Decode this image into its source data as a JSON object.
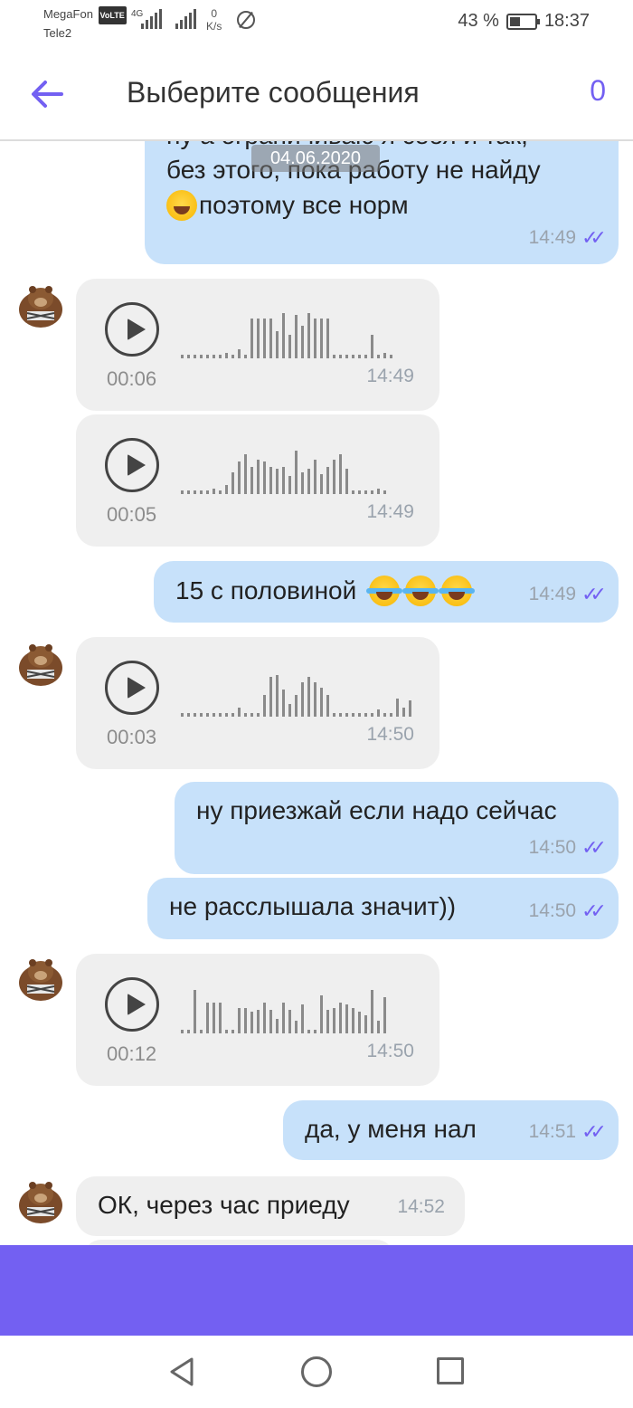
{
  "status_bar": {
    "carrier1": "MegaFon",
    "volte": "VoLTE",
    "network1": "4G",
    "carrier2": "Tele2",
    "speed_value": "0",
    "speed_unit": "K/s",
    "battery": "43 %",
    "battery_level": 0.43,
    "time": "18:37"
  },
  "header": {
    "title": "Выберите сообщения",
    "selected_count": "0"
  },
  "chat": {
    "date_chip": "04.06.2020",
    "messages": [
      {
        "type": "text",
        "direction": "out",
        "text_line1": "ну а ограничиваю я себя и так,",
        "text_line2": "без этого, пока работу не найду",
        "text_line3": "поэтому все норм",
        "time": "14:49"
      },
      {
        "type": "voice",
        "direction": "in",
        "duration": "00:06",
        "time": "14:49"
      },
      {
        "type": "voice",
        "direction": "in",
        "duration": "00:05",
        "time": "14:49"
      },
      {
        "type": "text",
        "direction": "out",
        "text": "15 с половиной",
        "time": "14:49"
      },
      {
        "type": "voice",
        "direction": "in",
        "duration": "00:03",
        "time": "14:50"
      },
      {
        "type": "text",
        "direction": "out",
        "text": "ну приезжай если надо сейчас",
        "time": "14:50"
      },
      {
        "type": "text",
        "direction": "out",
        "text": "не расслышала значит))",
        "time": "14:50"
      },
      {
        "type": "voice",
        "direction": "in",
        "duration": "00:12",
        "time": "14:50"
      },
      {
        "type": "text",
        "direction": "out",
        "text": "да, у меня нал",
        "time": "14:51"
      },
      {
        "type": "text",
        "direction": "in",
        "text": "ОК, через час приеду",
        "time": "14:52"
      }
    ]
  },
  "colors": {
    "accent": "#7360f2",
    "outgoing_bubble": "#c7e1fa",
    "incoming_bubble": "#efefef"
  }
}
